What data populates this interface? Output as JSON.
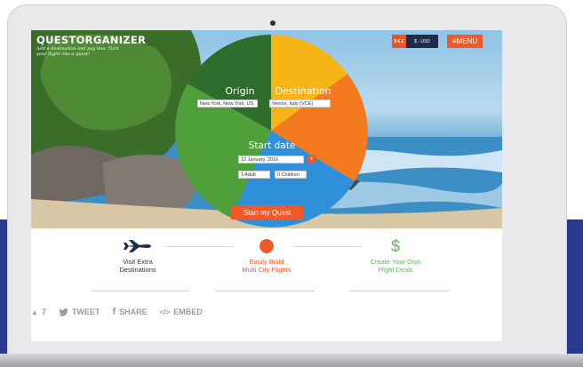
{
  "hero": {
    "logo": "QUESTORGANIZER",
    "tagline": "Add a destination and pay less. Turn your flight into a quest!",
    "currency": {
      "icon_text": "$ € £",
      "label": "$ - USD"
    },
    "menu_label": "≡MENU",
    "origin": {
      "label": "Origin",
      "value": "New York, New York, US"
    },
    "destination": {
      "label": "Destination",
      "value": "Venice, Italy (VCE)"
    },
    "start_date": {
      "label": "Start date",
      "date_value": "12 January, 2016",
      "adults_value": "1 Adult",
      "children_value": "0 Children"
    },
    "cta_label": "Start my Quest"
  },
  "features": [
    {
      "icon": "airplane-icon",
      "title": "Visit Extra\nDestinations",
      "color": "#1f2b4a"
    },
    {
      "icon": "orange-dot-icon",
      "title": "Easily Build\nMulti City Flights",
      "color": "#f05a28"
    },
    {
      "icon": "dollar-icon",
      "title": "Create Your Own\nFlight Deals",
      "color": "#5cb85c"
    }
  ],
  "social": {
    "upvote_count": "7",
    "tweet_label": "TWEET",
    "share_label": "SHARE",
    "embed_label": "EMBED"
  },
  "colors": {
    "accent": "#f05a28",
    "navy": "#1f2b4a",
    "green": "#5cb85c",
    "band": "#2a3990"
  }
}
